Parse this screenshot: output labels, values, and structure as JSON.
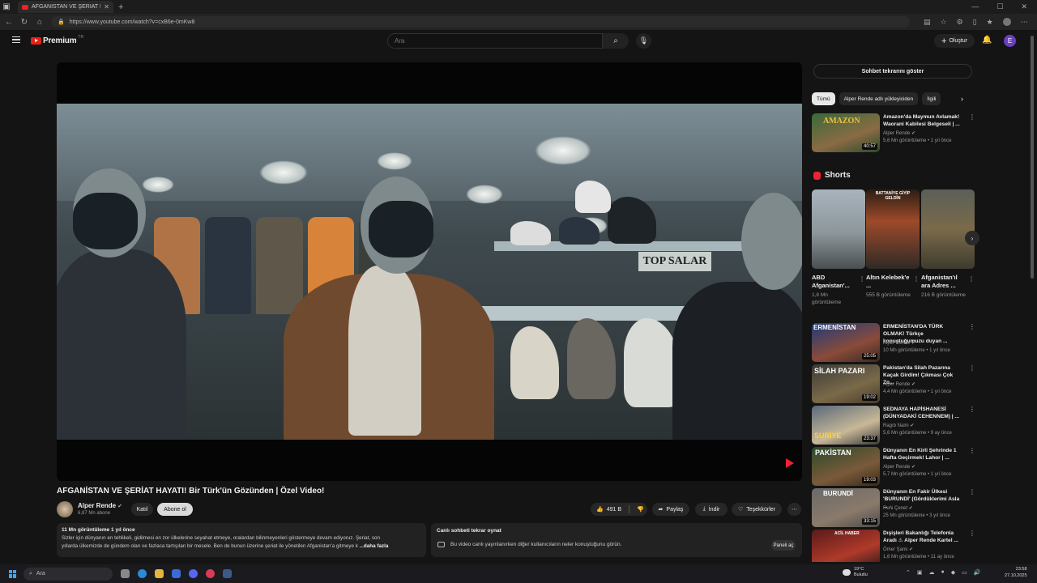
{
  "browser": {
    "tab_title": "AFGANİSTAN VE ŞERİAT HAYATI! B",
    "url": "https://www.youtube.com/watch?v=cxB6e-0mKw8"
  },
  "header": {
    "logo_text": "Premium",
    "logo_badge": "TR",
    "search_placeholder": "Ara",
    "create_label": "Oluştur",
    "avatar_letter": "E"
  },
  "video": {
    "title": "AFGANİSTAN VE ŞERİAT HAYATI! Bir Türk'ün Gözünden | Özel Video!",
    "sign_text": "TOP SALAR",
    "channel_name": "Alper Rende",
    "subscribers": "6,87 Mn abone",
    "join_label": "Katıl",
    "subscribe_label": "Abone ol",
    "likes": "491 B",
    "share_label": "Paylaş",
    "download_label": "İndir",
    "thanks_label": "Teşekkürler"
  },
  "description": {
    "meta": "11 Mn görüntüleme  1 yıl önce",
    "line1": "Sizler için dünyanın en tehlikeli, gidilmesi en zor ülkelerine seyahat etmeye, oralardan bilinmeyenleri göstermeye devam ediyoruz. Şeriat, son",
    "line2": "yıllarda ülkemizde de gündem olan ve fazlaca tartışılan bir mesele. Ben de bunun üzerine şeriat ile yönetilen Afganistan'a gitmeye k",
    "more": "...daha fazla"
  },
  "live_chat": {
    "heading": "Canlı sohbeti tekrar oynat",
    "desc": "Bu video canlı yayınlanırken diğer kullanıcıların neler konuştuğunu görün.",
    "button": "Paneli aç"
  },
  "sidebar": {
    "chat_button": "Sohbet tekrarını göster",
    "chips": [
      "Tümü",
      "Alper Rende adlı yükleyiciden",
      "İlgili"
    ],
    "top_rec": {
      "title": "Amazon'da Maymun Avlamak! Waorani Kabilesi Belgeseli | ...",
      "channel": "Alper Rende",
      "views": "5,6 Mn görüntüleme • 1 yıl önce",
      "duration": "40:57",
      "thumb_text": "AMAZON"
    },
    "shorts_heading": "Shorts",
    "shorts": [
      {
        "title": "ABD Afganistan'...",
        "views": "1,8 Mn görüntüleme"
      },
      {
        "title": "Altın Kelebek'e ...",
        "views": "555 B görüntüleme",
        "thumb_text": "BATTANİYE GİYİP GELDİN"
      },
      {
        "title": "Afganistan'ıl ara Adres ...",
        "views": "216 B görüntüleme"
      }
    ],
    "recs": [
      {
        "title": "ERMENİSTAN'DA TÜRK OLMAK! Türkçe konuştuğumuzu duyan ...",
        "channel": "Alper Rende",
        "views": "10 Mn görüntüleme • 1 yıl önce",
        "duration": "25:05",
        "thumb_text": "ERMENİSTAN"
      },
      {
        "title": "Pakistan'da Silah Pazarına Kaçak Girdim! Çıkması Çok Zo...",
        "channel": "Alper Rende",
        "views": "4,4 Mn görüntüleme • 1 yıl önce",
        "duration": "19:02",
        "thumb_text": "SİLAH PAZARI"
      },
      {
        "title": "SEDNAYA HAPİSHANESİ (DÜNYADAKİ CEHENNEM) | ...",
        "channel": "Ragıb Naim",
        "views": "5,6 Mn görüntüleme • 9 ay önce",
        "duration": "23:37",
        "thumb_text": "SURİYE"
      },
      {
        "title": "Dünyanın En Kirli Şehrinde 1 Hafta Geçirmek! Lahor | ...",
        "channel": "Alper Rende",
        "views": "5,7 Mn görüntüleme • 1 yıl önce",
        "duration": "19:03",
        "thumb_text": "PAKİSTAN"
      },
      {
        "title": "Dünyanın En Fakir Ülkesi 'BURUNDİ' (Gördüklerimi Asla ...",
        "channel": "Ruhi Çenet",
        "views": "25 Mn görüntüleme • 3 yıl önce",
        "duration": "33:15",
        "thumb_text": "BURUNDİ"
      },
      {
        "title": "Dışişleri Bakanlığı Telefonla Aradı ⚠ Alper Rende Kartel ...",
        "channel": "Ömer Şanlı",
        "views": "1,6 Mn görüntüleme • 11 ay önce",
        "duration": "",
        "thumb_text": "ACİL HABER"
      }
    ]
  },
  "taskbar": {
    "search_label": "Ara",
    "temp": "19°C",
    "weather": "Bulutlu",
    "time": "23:58",
    "date": "27.10.2025"
  },
  "colors": {
    "accent": "#e62117",
    "bg": "#141414",
    "surface": "#272727"
  }
}
